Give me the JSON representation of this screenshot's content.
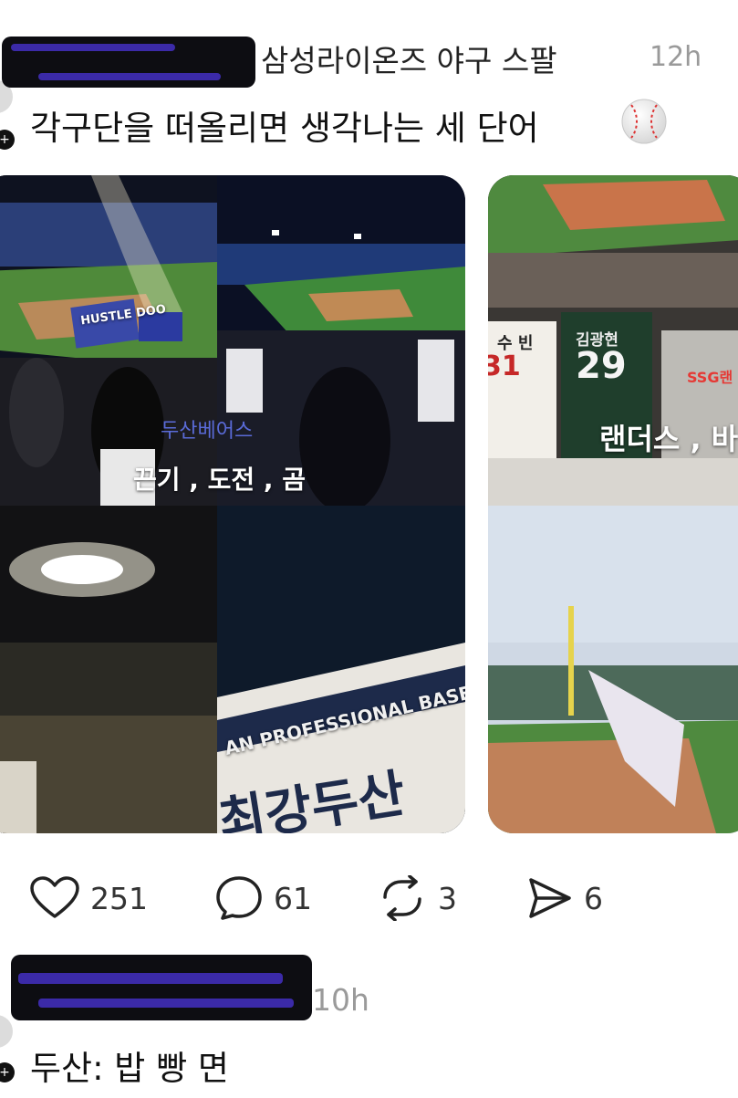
{
  "post1": {
    "username_tail": "삼성라이온즈 야구 스팔",
    "time": "12h",
    "text": "각구단을 떠올리면 생각나는 세 단어",
    "emoji_icon": "baseball-icon",
    "images": [
      {
        "overlay_faint": "두산베어스",
        "overlay": "끈기 , 도전 , 곰"
      },
      {
        "overlay": "랜더스 , 바",
        "badge": "SSG랜",
        "jersey_name": "김광현",
        "jersey_number": "29",
        "jersey_left_name": "수 빈",
        "jersey_left_number": "31"
      }
    ],
    "banner_text": "AN PROFESSIONAL BASEBALL CL",
    "banner_big": "최강두산",
    "stadium_banner": "HUSTLE DOO",
    "actions": {
      "likes": "251",
      "comments": "61",
      "reposts": "3",
      "shares": "6"
    }
  },
  "post2": {
    "time": "10h",
    "text": "두산: 밥 빵 면"
  },
  "colors": {
    "muted": "#9a9a9a",
    "redaction": "#0d0d12",
    "redaction_scribble": "#3b2aa8"
  }
}
